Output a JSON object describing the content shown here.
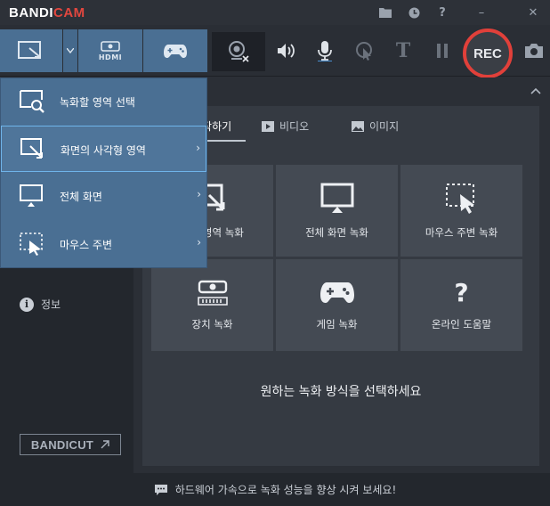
{
  "app": {
    "logo_main": "BANDI",
    "logo_accent": "CAM",
    "title_icons": [
      "folder-icon",
      "clock-icon",
      "help-icon",
      "minimize-icon",
      "close-icon"
    ],
    "help_glyph": "?",
    "minimize_glyph": "–",
    "close_glyph": "✕"
  },
  "toolbar": {
    "hdmi_label": "HDMI",
    "text_tool": "T",
    "rec_label": "REC"
  },
  "dropdown": {
    "items": [
      {
        "label": "녹화할 영역 선택",
        "has_submenu": false
      },
      {
        "label": "화면의 사각형 영역",
        "has_submenu": true
      },
      {
        "label": "전체 화면",
        "has_submenu": true
      },
      {
        "label": "마우스 주변",
        "has_submenu": true
      }
    ],
    "arrow_glyph": "›"
  },
  "sidebar": {
    "info_label": "정보",
    "info_glyph": "i",
    "bandicut_label": "BANDICUT"
  },
  "main": {
    "tabs": [
      {
        "label": "시작하기",
        "active": true
      },
      {
        "label": "비디오",
        "active": false
      },
      {
        "label": "이미지",
        "active": false
      }
    ],
    "grid": [
      {
        "label": "화면 영역 녹화",
        "icon": "rect-area-icon"
      },
      {
        "label": "전체 화면 녹화",
        "icon": "fullscreen-icon"
      },
      {
        "label": "마우스 주변 녹화",
        "icon": "mouse-area-icon"
      },
      {
        "label": "장치 녹화",
        "icon": "hdmi-device-icon"
      },
      {
        "label": "게임 녹화",
        "icon": "gamepad-icon"
      },
      {
        "label": "온라인 도움말",
        "icon": "help-icon"
      }
    ],
    "help_glyph": "?",
    "prompt": "원하는 녹화 방식을 선택하세요"
  },
  "footer": {
    "message": "하드웨어 가속으로 녹화 성능을 향상 시켜 보세요!"
  },
  "colors": {
    "accent": "#4a6f93",
    "rec_ring": "#e1403a",
    "logo_accent": "#e2473f",
    "selected_border": "#6fb4ea"
  }
}
